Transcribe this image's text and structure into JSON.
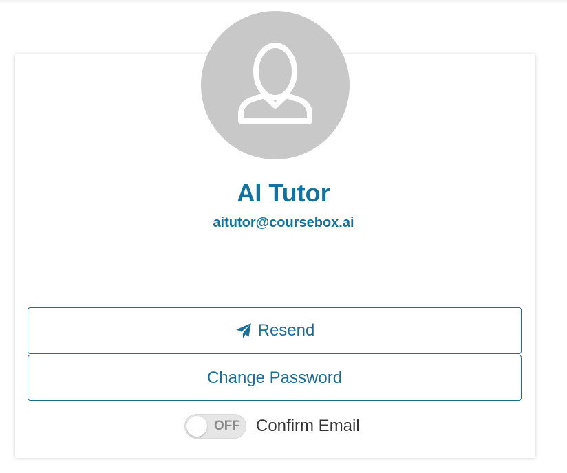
{
  "profile": {
    "name": "AI Tutor",
    "email": "aitutor@coursebox.ai",
    "avatar_icon": "user-silhouette-icon"
  },
  "actions": {
    "resend_label": "Resend",
    "resend_icon": "paper-plane-icon",
    "change_password_label": "Change Password"
  },
  "confirm_email": {
    "toggle_state": "OFF",
    "label": "Confirm Email"
  },
  "colors": {
    "accent": "#13729f",
    "avatar_bg": "#c8c8c8"
  }
}
